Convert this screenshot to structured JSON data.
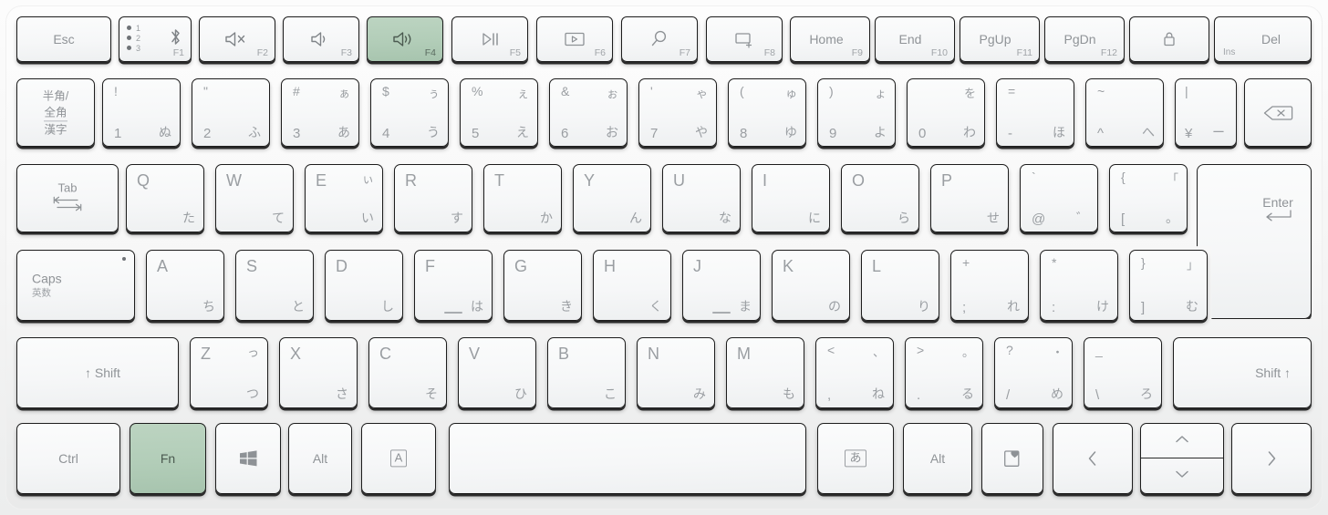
{
  "device": {
    "name": "bluetooth-keyboard-jis",
    "layout": "Japanese JIS",
    "highlight_color": "#b2cdb8",
    "key_face_color": "#f7f8f9",
    "key_text_color": "#8f9397",
    "body_color": "#f7f7f7"
  },
  "highlighted_keys": [
    "F4",
    "Fn"
  ],
  "rows": {
    "function_row": [
      {
        "id": "esc",
        "label": "Esc",
        "fn": "",
        "icon": "",
        "highlight": false
      },
      {
        "id": "f1",
        "label": "",
        "fn": "F1",
        "icon": "bluetooth-icon",
        "highlight": false,
        "leds": [
          "1",
          "2",
          "3"
        ]
      },
      {
        "id": "f2",
        "label": "",
        "fn": "F2",
        "icon": "volume-mute-icon",
        "highlight": false
      },
      {
        "id": "f3",
        "label": "",
        "fn": "F3",
        "icon": "volume-down-icon",
        "highlight": false
      },
      {
        "id": "f4",
        "label": "",
        "fn": "F4",
        "icon": "volume-up-icon",
        "highlight": true
      },
      {
        "id": "f5",
        "label": "",
        "fn": "F5",
        "icon": "play-pause-icon",
        "highlight": false
      },
      {
        "id": "f6",
        "label": "",
        "fn": "F6",
        "icon": "media-screen-icon",
        "highlight": false
      },
      {
        "id": "f7",
        "label": "",
        "fn": "F7",
        "icon": "search-icon",
        "highlight": false
      },
      {
        "id": "f8",
        "label": "",
        "fn": "F8",
        "icon": "new-window-icon",
        "highlight": false
      },
      {
        "id": "f9",
        "label": "Home",
        "fn": "F9",
        "icon": "",
        "highlight": false
      },
      {
        "id": "f10",
        "label": "End",
        "fn": "F10",
        "icon": "",
        "highlight": false
      },
      {
        "id": "f11",
        "label": "PgUp",
        "fn": "F11",
        "icon": "",
        "highlight": false
      },
      {
        "id": "f12",
        "label": "PgDn",
        "fn": "F12",
        "icon": "",
        "highlight": false
      },
      {
        "id": "lock",
        "label": "",
        "fn": "",
        "icon": "lock-icon",
        "highlight": false
      },
      {
        "id": "del",
        "label": "Del",
        "fn": "",
        "icon": "",
        "sub": "Ins",
        "highlight": false
      }
    ],
    "number_row": [
      {
        "id": "hankaku",
        "l1": "半角/",
        "l2": "全角",
        "l3": "漢字"
      },
      {
        "id": "1",
        "sym_top": "!",
        "sym_bot": "1",
        "kana_bot": "ぬ"
      },
      {
        "id": "2",
        "sym_top": "\"",
        "sym_bot": "2",
        "kana_bot": "ふ"
      },
      {
        "id": "3",
        "sym_top": "#",
        "sym_bot": "3",
        "kana_top": "ぁ",
        "kana_bot": "あ"
      },
      {
        "id": "4",
        "sym_top": "$",
        "sym_bot": "4",
        "kana_top": "ぅ",
        "kana_bot": "う"
      },
      {
        "id": "5",
        "sym_top": "%",
        "sym_bot": "5",
        "kana_top": "ぇ",
        "kana_bot": "え"
      },
      {
        "id": "6",
        "sym_top": "&",
        "sym_bot": "6",
        "kana_top": "ぉ",
        "kana_bot": "お"
      },
      {
        "id": "7",
        "sym_top": "'",
        "sym_bot": "7",
        "kana_top": "ゃ",
        "kana_bot": "や"
      },
      {
        "id": "8",
        "sym_top": "(",
        "sym_bot": "8",
        "kana_top": "ゅ",
        "kana_bot": "ゆ"
      },
      {
        "id": "9",
        "sym_top": ")",
        "sym_bot": "9",
        "kana_top": "ょ",
        "kana_bot": "よ"
      },
      {
        "id": "0",
        "sym_top": "",
        "sym_bot": "0",
        "kana_top": "を",
        "kana_bot": "わ"
      },
      {
        "id": "minus",
        "sym_top": "=",
        "sym_bot": "-",
        "kana_bot": "ほ"
      },
      {
        "id": "caret",
        "sym_top": "~",
        "sym_bot": "^",
        "kana_bot": "へ"
      },
      {
        "id": "yen",
        "sym_top": "|",
        "sym_bot": "¥",
        "kana_bot": "ー"
      },
      {
        "id": "backspace",
        "icon": "backspace-icon"
      }
    ],
    "qwerty_row": [
      {
        "id": "tab",
        "label": "Tab",
        "icon": "tab-arrows-icon"
      },
      {
        "id": "q",
        "alpha": "Q",
        "kana": "た"
      },
      {
        "id": "w",
        "alpha": "W",
        "kana": "て"
      },
      {
        "id": "e",
        "alpha": "E",
        "kana_top": "ぃ",
        "kana": "い"
      },
      {
        "id": "r",
        "alpha": "R",
        "kana": "す"
      },
      {
        "id": "t",
        "alpha": "T",
        "kana": "か"
      },
      {
        "id": "y",
        "alpha": "Y",
        "kana": "ん"
      },
      {
        "id": "u",
        "alpha": "U",
        "kana": "な"
      },
      {
        "id": "i",
        "alpha": "I",
        "kana": "に"
      },
      {
        "id": "o",
        "alpha": "O",
        "kana": "ら"
      },
      {
        "id": "p",
        "alpha": "P",
        "kana": "せ"
      },
      {
        "id": "at",
        "sym_top": "`",
        "sym_bot": "@",
        "kana_bot": "゛"
      },
      {
        "id": "bracket_left",
        "sym_top": "{",
        "sym_bot": "[",
        "kana_top": "「",
        "kana_bot": "。"
      },
      {
        "id": "enter",
        "label": "Enter",
        "icon": "enter-arrow-icon"
      }
    ],
    "home_row": [
      {
        "id": "caps",
        "l1": "Caps",
        "l2": "英数",
        "led": true
      },
      {
        "id": "a",
        "alpha": "A",
        "kana": "ち"
      },
      {
        "id": "s",
        "alpha": "S",
        "kana": "と"
      },
      {
        "id": "d",
        "alpha": "D",
        "kana": "し"
      },
      {
        "id": "f",
        "alpha": "F",
        "kana": "は",
        "homing": true
      },
      {
        "id": "g",
        "alpha": "G",
        "kana": "き"
      },
      {
        "id": "h",
        "alpha": "H",
        "kana": "く"
      },
      {
        "id": "j",
        "alpha": "J",
        "kana": "ま",
        "homing": true
      },
      {
        "id": "k",
        "alpha": "K",
        "kana": "の"
      },
      {
        "id": "l",
        "alpha": "L",
        "kana": "り"
      },
      {
        "id": "semicolon",
        "sym_top": "+",
        "sym_bot": ";",
        "kana_bot": "れ"
      },
      {
        "id": "colon",
        "sym_top": "*",
        "sym_bot": ":",
        "kana_bot": "け"
      },
      {
        "id": "bracket_right",
        "sym_top": "}",
        "sym_bot": "]",
        "kana_top": "」",
        "kana_bot": "む"
      }
    ],
    "zxcv_row": [
      {
        "id": "shift_left",
        "label": "↑ Shift"
      },
      {
        "id": "z",
        "alpha": "Z",
        "kana_top": "っ",
        "kana": "つ"
      },
      {
        "id": "x",
        "alpha": "X",
        "kana": "さ"
      },
      {
        "id": "c",
        "alpha": "C",
        "kana": "そ"
      },
      {
        "id": "v",
        "alpha": "V",
        "kana": "ひ"
      },
      {
        "id": "b",
        "alpha": "B",
        "kana": "こ"
      },
      {
        "id": "n",
        "alpha": "N",
        "kana": "み"
      },
      {
        "id": "m",
        "alpha": "M",
        "kana": "も"
      },
      {
        "id": "comma",
        "sym_top": "<",
        "sym_bot": ",",
        "kana_top": "、",
        "kana_bot": "ね"
      },
      {
        "id": "period",
        "sym_top": ">",
        "sym_bot": ".",
        "kana_top": "。",
        "kana_bot": "る"
      },
      {
        "id": "slash",
        "sym_top": "?",
        "sym_bot": "/",
        "kana_top": "・",
        "kana_bot": "め"
      },
      {
        "id": "underscore",
        "sym_top": "_",
        "sym_bot": "\\",
        "kana_bot": "ろ"
      },
      {
        "id": "shift_right",
        "label": "Shift ↑"
      }
    ],
    "bottom_row": [
      {
        "id": "ctrl",
        "label": "Ctrl",
        "highlight": false
      },
      {
        "id": "fn",
        "label": "Fn",
        "highlight": true
      },
      {
        "id": "win",
        "label": "",
        "icon": "windows-icon",
        "highlight": false
      },
      {
        "id": "alt_left",
        "label": "Alt",
        "highlight": false
      },
      {
        "id": "muhenkan",
        "label": "A",
        "boxed": true,
        "highlight": false
      },
      {
        "id": "space",
        "label": "",
        "highlight": false
      },
      {
        "id": "henkan",
        "label": "あ",
        "boxed": true,
        "highlight": false
      },
      {
        "id": "alt_right",
        "label": "Alt",
        "highlight": false
      },
      {
        "id": "favorites",
        "label": "",
        "icon": "favorites-heart-icon",
        "highlight": false
      },
      {
        "id": "arrow_left",
        "label": "",
        "icon": "chevron-left-icon",
        "highlight": false
      },
      {
        "id": "arrow_updown",
        "label": "",
        "icon": "chevron-up-down-icon",
        "highlight": false
      },
      {
        "id": "arrow_right",
        "label": "",
        "icon": "chevron-right-icon",
        "highlight": false
      }
    ]
  }
}
